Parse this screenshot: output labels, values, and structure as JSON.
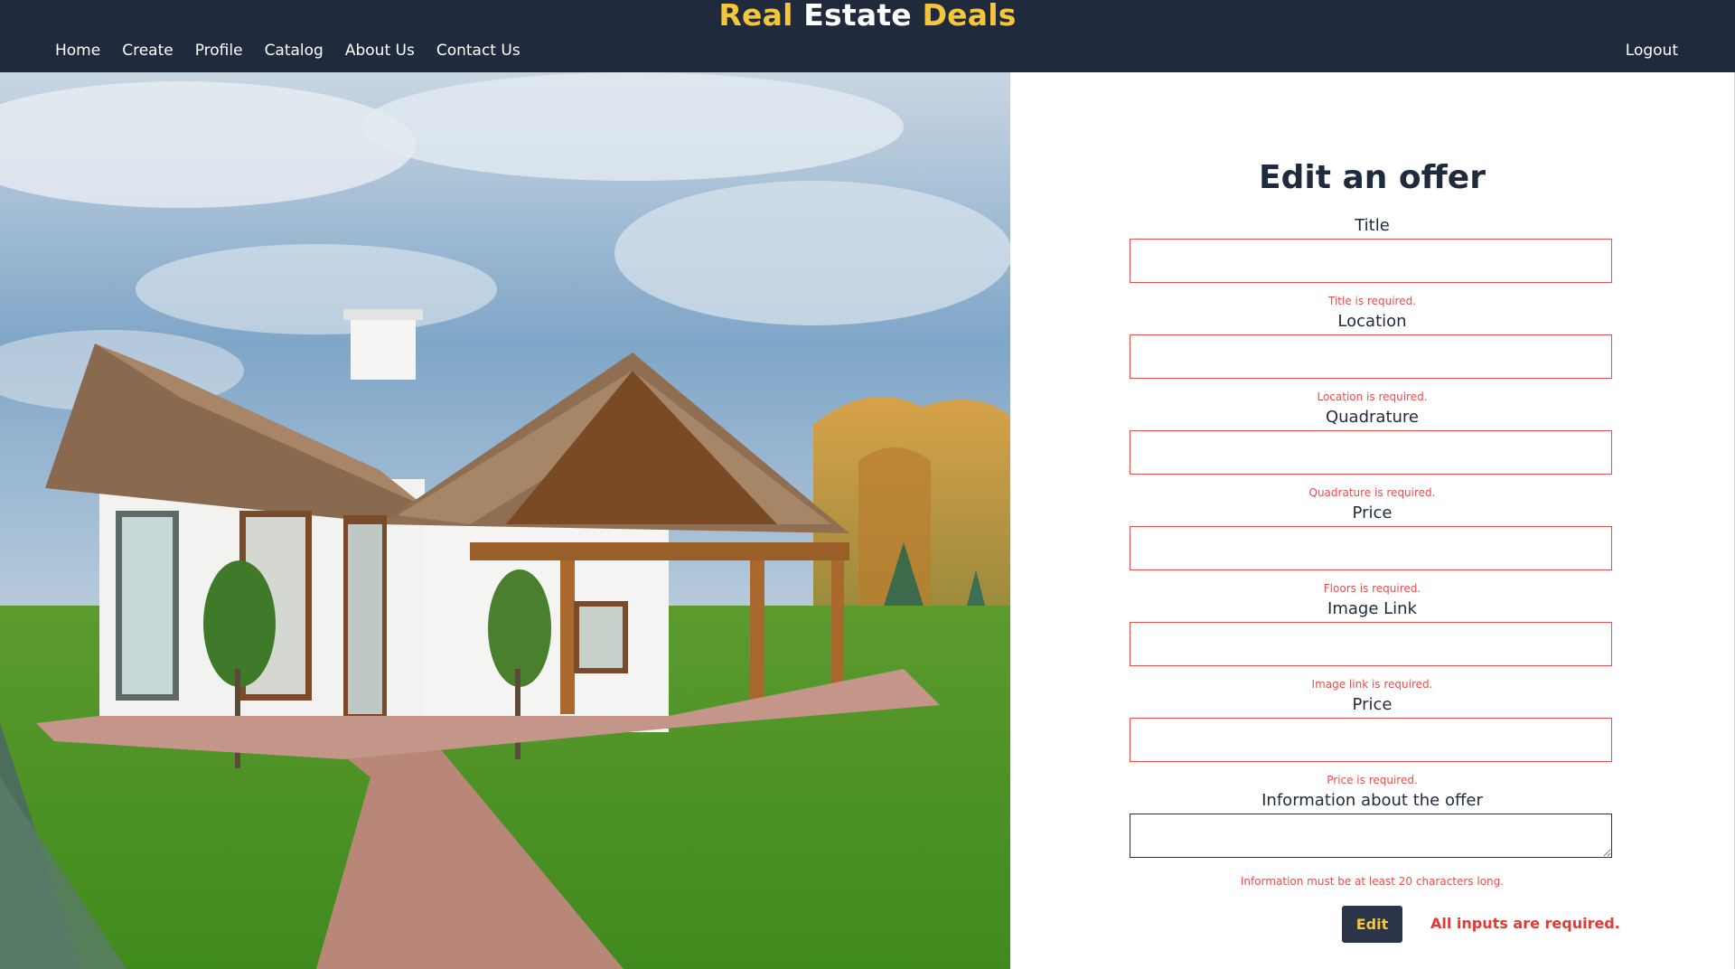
{
  "header": {
    "brand": {
      "part1": "Real",
      "part2": "Estate",
      "part3": "Deals"
    },
    "nav": [
      "Home",
      "Create",
      "Profile",
      "Catalog",
      "About Us",
      "Contact Us"
    ],
    "logout": "Logout"
  },
  "form": {
    "title": "Edit an offer",
    "fields": [
      {
        "label": "Title",
        "error": "Title is required.",
        "value": ""
      },
      {
        "label": "Location",
        "error": "Location is required.",
        "value": ""
      },
      {
        "label": "Quadrature",
        "error": "Quadrature is required.",
        "value": ""
      },
      {
        "label": "Price",
        "error": "Floors is required.",
        "value": ""
      },
      {
        "label": "Image Link",
        "error": "Image link is required.",
        "value": ""
      },
      {
        "label": "Price",
        "error": "Price is required.",
        "value": ""
      }
    ],
    "info": {
      "label": "Information about the offer",
      "error": "Information must be at least 20 characters long.",
      "value": ""
    },
    "submit_label": "Edit",
    "global_error": "All inputs are required."
  },
  "colors": {
    "header_bg": "#1f2a3d",
    "brand_yellow": "#f6c63a",
    "error_red": "#ea4d4d",
    "button_bg": "#2c3548"
  }
}
